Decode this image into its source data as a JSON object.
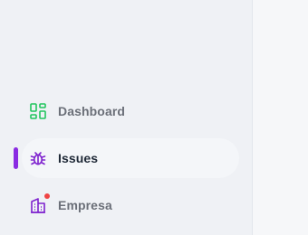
{
  "sidebar": {
    "items": [
      {
        "label": "Dashboard",
        "icon": "dashboard-grid-icon",
        "active": false,
        "icon_color": "#22c55e"
      },
      {
        "label": "Issues",
        "icon": "bug-icon",
        "active": true,
        "icon_color": "#7e22ce"
      },
      {
        "label": "Empresa",
        "icon": "building-icon",
        "active": false,
        "icon_color": "#7e22ce",
        "badge_color": "#ef4444"
      }
    ],
    "active_indicator_color": "#8a2be2"
  }
}
